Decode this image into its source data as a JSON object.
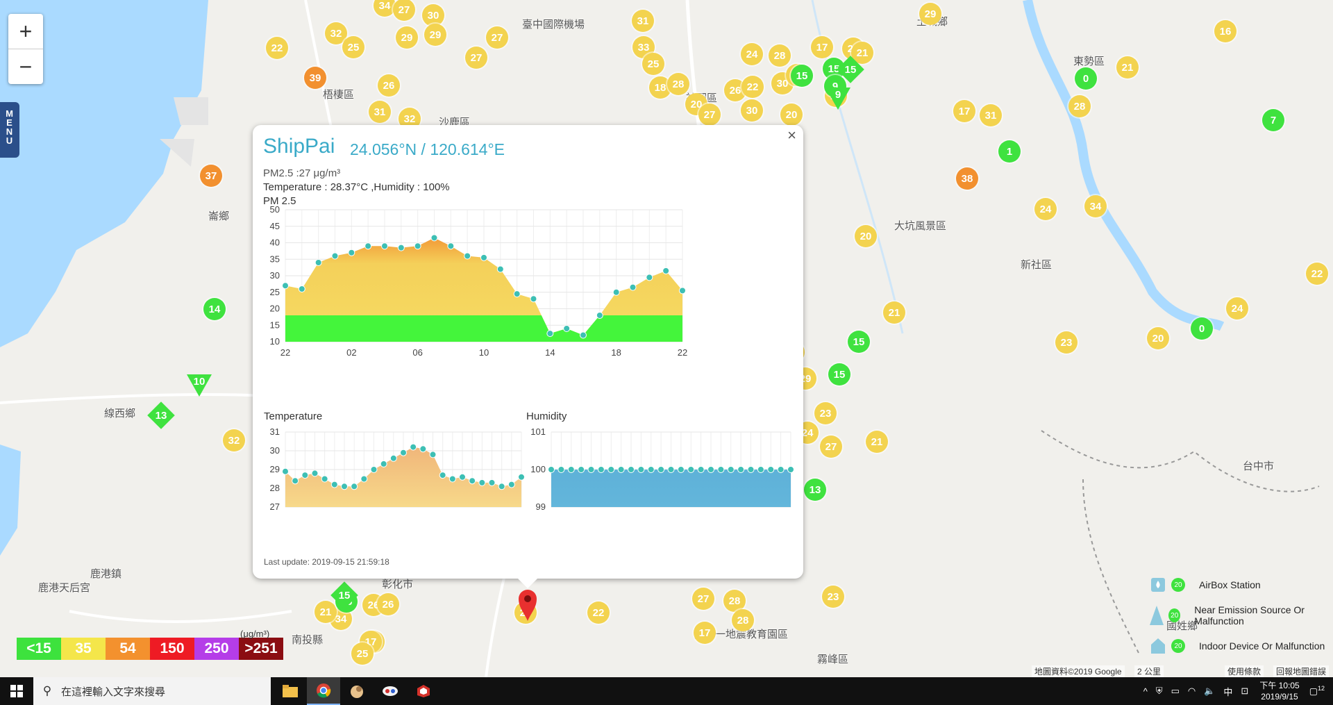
{
  "map": {
    "labels": [
      "臺中國際機場",
      "梧棲區",
      "沙鹿區",
      "神岡區",
      "東勢區",
      "新社區",
      "大坑風景區",
      "線西鄉",
      "鹿港鎮",
      "彰化市",
      "霧峰區",
      "鹿港天后宮",
      "台中市",
      "國姓鄉",
      "南投縣",
      "九二一地震教育園區",
      "崙鄉",
      "土城鄉"
    ],
    "markers": {
      "yellow": [
        "34",
        "27",
        "30",
        "22",
        "32",
        "25",
        "29",
        "29",
        "27",
        "27",
        "26",
        "31",
        "32",
        "31",
        "33",
        "25",
        "18",
        "28",
        "20",
        "27",
        "26",
        "22",
        "17",
        "21",
        "29",
        "16",
        "24",
        "28",
        "30",
        "23",
        "21",
        "19",
        "30",
        "20",
        "17",
        "31",
        "21",
        "28",
        "24",
        "34",
        "20",
        "21",
        "23",
        "24",
        "22",
        "20",
        "29",
        "23",
        "27",
        "21",
        "24",
        "26",
        "32",
        "34",
        "28",
        "27",
        "17",
        "26",
        "28",
        "23",
        "22",
        "27",
        "21",
        "26",
        "29",
        "17",
        "25"
      ],
      "green": [
        "15",
        "15",
        "0",
        "1",
        "7",
        "14",
        "9",
        "15",
        "13",
        "15",
        "0",
        "15"
      ],
      "orange": [
        "39",
        "37",
        "38"
      ],
      "diamonds": [
        "13",
        "15",
        "15"
      ],
      "triangles": [
        "10",
        "9"
      ]
    }
  },
  "controls": {
    "zoom_in": "+",
    "zoom_out": "−",
    "menu": "MENU"
  },
  "legend": {
    "levels": [
      {
        "label": "<15",
        "color": "#3de23d"
      },
      {
        "label": "35",
        "color": "#f4e64a"
      },
      {
        "label": "54",
        "color": "#f3912e"
      },
      {
        "label": "150",
        "color": "#ee1b24"
      },
      {
        "label": "250",
        "color": "#b53de8"
      },
      {
        "label": ">251",
        "color": "#8b0d12"
      }
    ],
    "unit": "(μg/m³)"
  },
  "station_legend": {
    "airbox": "AirBox Station",
    "emission": "Near Emission Source Or Malfunction",
    "indoor": "Indoor Device Or Malfunction",
    "badge": "20"
  },
  "attribution": {
    "data": "地圖資料©2019 Google",
    "scale": "2 公里",
    "terms": "使用條款",
    "report": "回報地圖錯誤"
  },
  "popup": {
    "site": "ShipPai",
    "coords": "24.056°N / 120.614°E",
    "pm25_line": "PM2.5 :27 μg/m³",
    "temp_line": "Temperature : 28.37°C ,Humidity : 100%",
    "pm_title": "PM 2.5",
    "temp_title": "Temperature",
    "hum_title": "Humidity",
    "last_update": "Last update: 2019-09-15 21:59:18",
    "close": "×"
  },
  "chart_data": [
    {
      "type": "area",
      "title": "PM 2.5",
      "x_ticks": [
        "22",
        "02",
        "06",
        "10",
        "14",
        "18",
        "22"
      ],
      "y_ticks": [
        10,
        15,
        20,
        25,
        30,
        35,
        40,
        45,
        50
      ],
      "ylim": [
        10,
        50
      ],
      "threshold": 18,
      "values": [
        27,
        26,
        34,
        36,
        37,
        39,
        39,
        38.5,
        39,
        41.5,
        39,
        36,
        35.5,
        32,
        24.5,
        23,
        12.5,
        14,
        12,
        18,
        25,
        26.5,
        29.5,
        31.5,
        25.5
      ]
    },
    {
      "type": "area",
      "title": "Temperature",
      "y_ticks": [
        27,
        28,
        29,
        30,
        31
      ],
      "ylim": [
        27,
        31
      ],
      "values": [
        28.9,
        28.4,
        28.7,
        28.8,
        28.5,
        28.2,
        28.1,
        28.1,
        28.5,
        29,
        29.3,
        29.6,
        29.9,
        30.2,
        30.1,
        29.8,
        28.7,
        28.5,
        28.6,
        28.4,
        28.3,
        28.3,
        28.1,
        28.2,
        28.6
      ]
    },
    {
      "type": "area",
      "title": "Humidity",
      "y_ticks": [
        99,
        100,
        101
      ],
      "ylim": [
        99,
        101
      ],
      "values": [
        100,
        100,
        100,
        100,
        100,
        100,
        100,
        100,
        100,
        100,
        100,
        100,
        100,
        100,
        100,
        100,
        100,
        100,
        100,
        100,
        100,
        100,
        100,
        100,
        100
      ]
    }
  ],
  "taskbar": {
    "search_placeholder": "在這裡輸入文字來搜尋",
    "time": "下午 10:05",
    "date": "2019/9/15",
    "ime": "中",
    "notifications": "12"
  }
}
